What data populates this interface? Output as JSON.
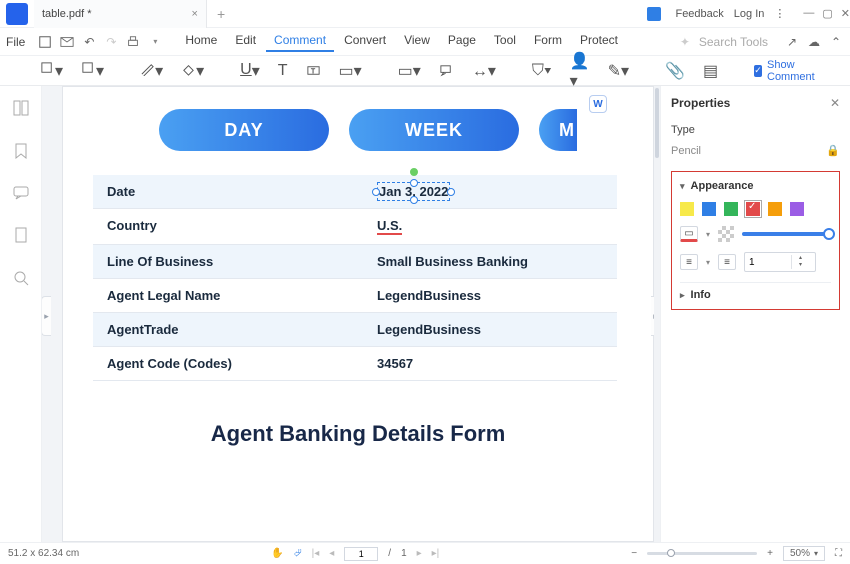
{
  "titlebar": {
    "tab_name": "table.pdf *",
    "feedback": "Feedback",
    "login": "Log In"
  },
  "menu": {
    "file": "File",
    "items": [
      "Home",
      "Edit",
      "Comment",
      "Convert",
      "View",
      "Page",
      "Tool",
      "Form",
      "Protect"
    ],
    "active_index": 2,
    "search_placeholder": "Search Tools"
  },
  "toolbar": {
    "show_comment": "Show Comment"
  },
  "document": {
    "pills": [
      "DAY",
      "WEEK",
      "M"
    ],
    "rows": [
      {
        "label": "Date",
        "value": "Jan 3, 2022"
      },
      {
        "label": "Country",
        "value": "U.S."
      },
      {
        "label": "Line Of Business",
        "value": "Small Business Banking"
      },
      {
        "label": "Agent Legal Name",
        "value": "LegendBusiness"
      },
      {
        "label": "AgentTrade",
        "value": "LegendBusiness"
      },
      {
        "label": "Agent Code (Codes)",
        "value": "34567"
      }
    ],
    "title": "Agent Banking Details Form"
  },
  "properties": {
    "header": "Properties",
    "type_label": "Type",
    "type_value": "Pencil",
    "appearance": "Appearance",
    "info": "Info",
    "thickness": "1",
    "colors": [
      "#f7e94a",
      "#2f7fe5",
      "#34b55a",
      "#e24a4a",
      "#f59e0b",
      "#9b5de5"
    ],
    "selected_color_index": 3
  },
  "status": {
    "dims": "51.2 x 62.34 cm",
    "page": "1",
    "pages": "1",
    "zoom": "50%"
  }
}
